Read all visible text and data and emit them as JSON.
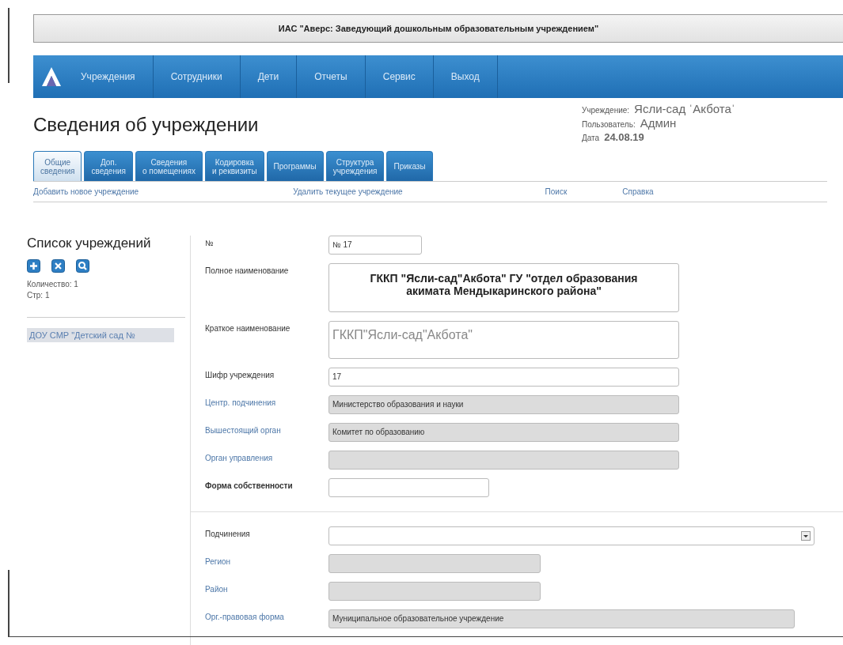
{
  "window": {
    "title": "ИАС \"Аверс: Заведующий дошкольным образовательным учреждением\""
  },
  "nav": [
    {
      "label": "Учреждения"
    },
    {
      "label": "Сотрудники"
    },
    {
      "label": "Дети"
    },
    {
      "label": "Отчеты"
    },
    {
      "label": "Сервис"
    },
    {
      "label": "Выход"
    }
  ],
  "page_title": "Сведения об учреждении",
  "info": [
    {
      "label": "Учреждение:",
      "value": "Ясли-сад  ˈАкботаˈ",
      "kind": "plain"
    },
    {
      "label": "Пользователь:",
      "value": "Админ",
      "kind": "plain"
    },
    {
      "label": "Дата",
      "value": "24.08.19",
      "kind": "bold"
    }
  ],
  "tabs": [
    {
      "label": "Общие\nсведения",
      "selected": true
    },
    {
      "label": "Доп.\nсведения",
      "selected": false
    },
    {
      "label": "Сведения\nо помещениях",
      "selected": false
    },
    {
      "label": "Кодировка\nи реквизиты",
      "selected": false
    },
    {
      "label": "Программы",
      "selected": false
    },
    {
      "label": "Структура\nучреждения",
      "selected": false
    },
    {
      "label": "Приказы",
      "selected": false
    }
  ],
  "actions": [
    {
      "label": "Добавить новое учреждение"
    },
    {
      "label": "Удалить текущее учреждение"
    },
    {
      "label": "Поиск"
    },
    {
      "label": "Справка"
    }
  ],
  "sidebar": {
    "title": "Список учреждений",
    "count": "Количество: 1",
    "page": "Стр: 1",
    "items": [
      {
        "label": "ДОУ СМР \"Детский сад №",
        "selected": true
      }
    ]
  },
  "form": {
    "sections": [
      {
        "fields": [
          {
            "label": "№",
            "linked": false,
            "kind": "input",
            "value": "№ 17"
          },
          {
            "label": "Полное наименование",
            "linked": false,
            "kind": "textarea",
            "value": "ГККП \"Ясли-сад\"Акбота\" ГУ \"отдел образования акимата Мендыкаринского района\""
          },
          {
            "label": "Краткое наименование",
            "linked": false,
            "kind": "textarea",
            "value": "ГККП\"Ясли-сад\"Акбота\""
          },
          {
            "label": "Шифр учреждения",
            "linked": false,
            "kind": "input",
            "value": "17"
          },
          {
            "label": "Центр. подчинения",
            "linked": true,
            "kind": "readonly",
            "value": "Министерство образования и науки"
          },
          {
            "label": "Вышестоящий орган",
            "linked": true,
            "kind": "readonly",
            "value": "Комитет по образованию"
          },
          {
            "label": "Орган управления",
            "linked": true,
            "kind": "readonly"
          },
          {
            "label": "Форма собственности",
            "linked": false,
            "kind": "input"
          }
        ]
      },
      {
        "fields": [
          {
            "label": "Подчинения",
            "linked": false,
            "kind": "select"
          },
          {
            "label": "Регион",
            "linked": true,
            "kind": "readonly"
          },
          {
            "label": "Район",
            "linked": true,
            "kind": "readonly"
          },
          {
            "label": "Орг.-правовая форма",
            "linked": true,
            "kind": "readonly",
            "value": "Муниципальное образовательное учреждение"
          }
        ]
      }
    ]
  }
}
